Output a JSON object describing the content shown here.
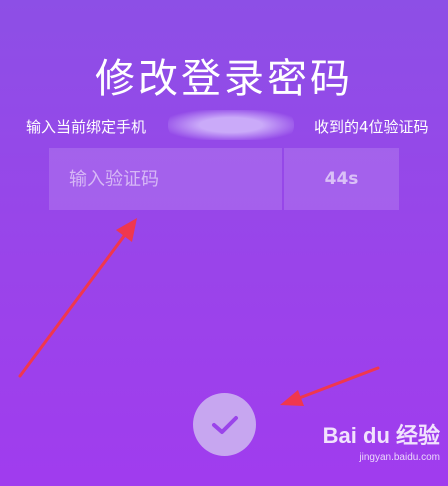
{
  "page": {
    "title": "修改登录密码",
    "instruction_prefix": "输入当前绑定手机",
    "instruction_suffix": "收到的4位验证码"
  },
  "verification": {
    "placeholder": "输入验证码",
    "countdown": "44s"
  },
  "confirm": {
    "icon": "checkmark-icon"
  },
  "watermark": {
    "logo": "Bai du 经验",
    "url": "jingyan.baidu.com"
  },
  "colors": {
    "accent": "#9a44ea",
    "confirm_bg": "#c7a6f0",
    "confirm_check": "#9a44ea",
    "arrow": "#f0374e"
  }
}
